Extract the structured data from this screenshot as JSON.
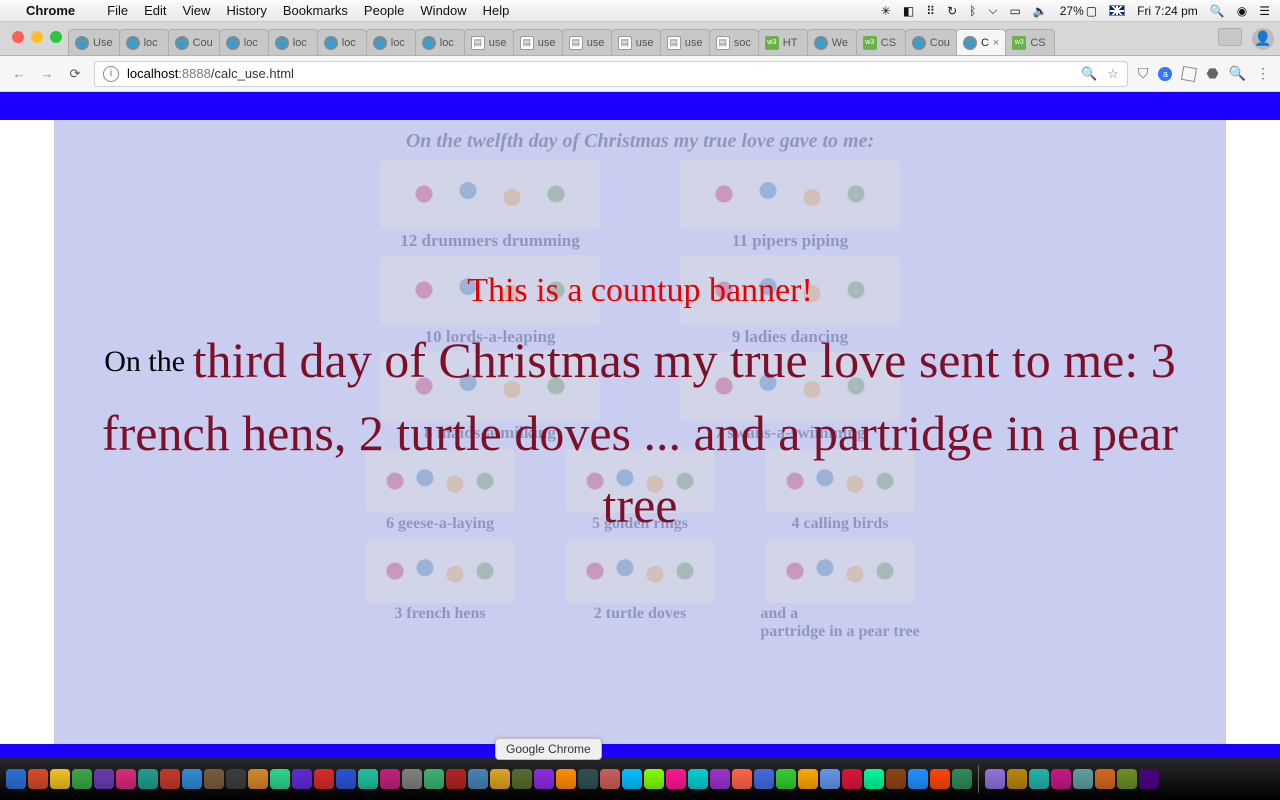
{
  "menubar": {
    "app": "Chrome",
    "items": [
      "File",
      "Edit",
      "View",
      "History",
      "Bookmarks",
      "People",
      "Window",
      "Help"
    ],
    "battery_pct": "27%",
    "clock": "Fri 7:24 pm"
  },
  "tabs": [
    {
      "fav": "globe",
      "label": "Use"
    },
    {
      "fav": "globe",
      "label": "loc"
    },
    {
      "fav": "globe",
      "label": "Cou"
    },
    {
      "fav": "globe",
      "label": "loc"
    },
    {
      "fav": "globe",
      "label": "loc"
    },
    {
      "fav": "globe",
      "label": "loc"
    },
    {
      "fav": "globe",
      "label": "loc"
    },
    {
      "fav": "globe",
      "label": "loc"
    },
    {
      "fav": "doc",
      "label": "use"
    },
    {
      "fav": "doc",
      "label": "use"
    },
    {
      "fav": "doc",
      "label": "use"
    },
    {
      "fav": "doc",
      "label": "use"
    },
    {
      "fav": "doc",
      "label": "use"
    },
    {
      "fav": "doc",
      "label": "soc"
    },
    {
      "fav": "w3",
      "label": "HT"
    },
    {
      "fav": "globe",
      "label": "We"
    },
    {
      "fav": "w3",
      "label": "CS"
    },
    {
      "fav": "globe",
      "label": "Cou"
    },
    {
      "fav": "globe",
      "label": "C",
      "active": true,
      "close": true
    },
    {
      "fav": "w3",
      "label": "CS"
    }
  ],
  "toolbar": {
    "host": "localhost",
    "port": ":8888",
    "path": "/calc_use.html"
  },
  "page": {
    "poster_title": "On the twelfth day of Christmas my true love gave to me:",
    "poster_items_top": [
      "12 drummers drumming",
      "11 pipers piping",
      "10 lords-a-leaping",
      "9 ladies dancing",
      "8 maids-a-milking",
      "7 swans-a-swimming"
    ],
    "poster_items_row3a": [
      "6 geese-a-laying",
      "5 golden rings",
      "4 calling birds"
    ],
    "poster_items_row3b": [
      "3 french hens",
      "2 turtle doves",
      "and a\npartridge in a pear tree"
    ],
    "banner_headline": "This is a countup banner!",
    "banner_prefix": "On the ",
    "banner_verse": "third day of Christmas my true love sent to me: 3 french hens, 2 turtle doves ... and a partridge in a pear tree"
  },
  "dock": {
    "tooltip": "Google Chrome",
    "colors": [
      "#2a6fd6",
      "#d64a2a",
      "#f0c020",
      "#39a845",
      "#6a3ab2",
      "#d62a7a",
      "#1e9e90",
      "#c0392b",
      "#2d8bd6",
      "#7a5c3e",
      "#3c3c3c",
      "#d6862a",
      "#2ad68b",
      "#5d2ad6",
      "#d62a2a",
      "#2a52d6",
      "#20c0a0",
      "#c0207a",
      "#808080",
      "#3cb371",
      "#b22222",
      "#4682b4",
      "#daa520",
      "#556b2f",
      "#8a2be2",
      "#ff8c00",
      "#2f4f4f",
      "#cd5c5c",
      "#00bfff",
      "#7fff00",
      "#ff1493",
      "#00ced1",
      "#9932cc",
      "#ff6347",
      "#4169e1",
      "#32cd32",
      "#ffa500",
      "#6495ed",
      "#dc143c",
      "#00fa9a",
      "#8b4513",
      "#1e90ff",
      "#ff4500",
      "#2e8b57",
      "#9370db",
      "#b8860b",
      "#20b2aa",
      "#c71585",
      "#5f9ea0",
      "#d2691e",
      "#6b8e23",
      "#4b0082"
    ]
  }
}
